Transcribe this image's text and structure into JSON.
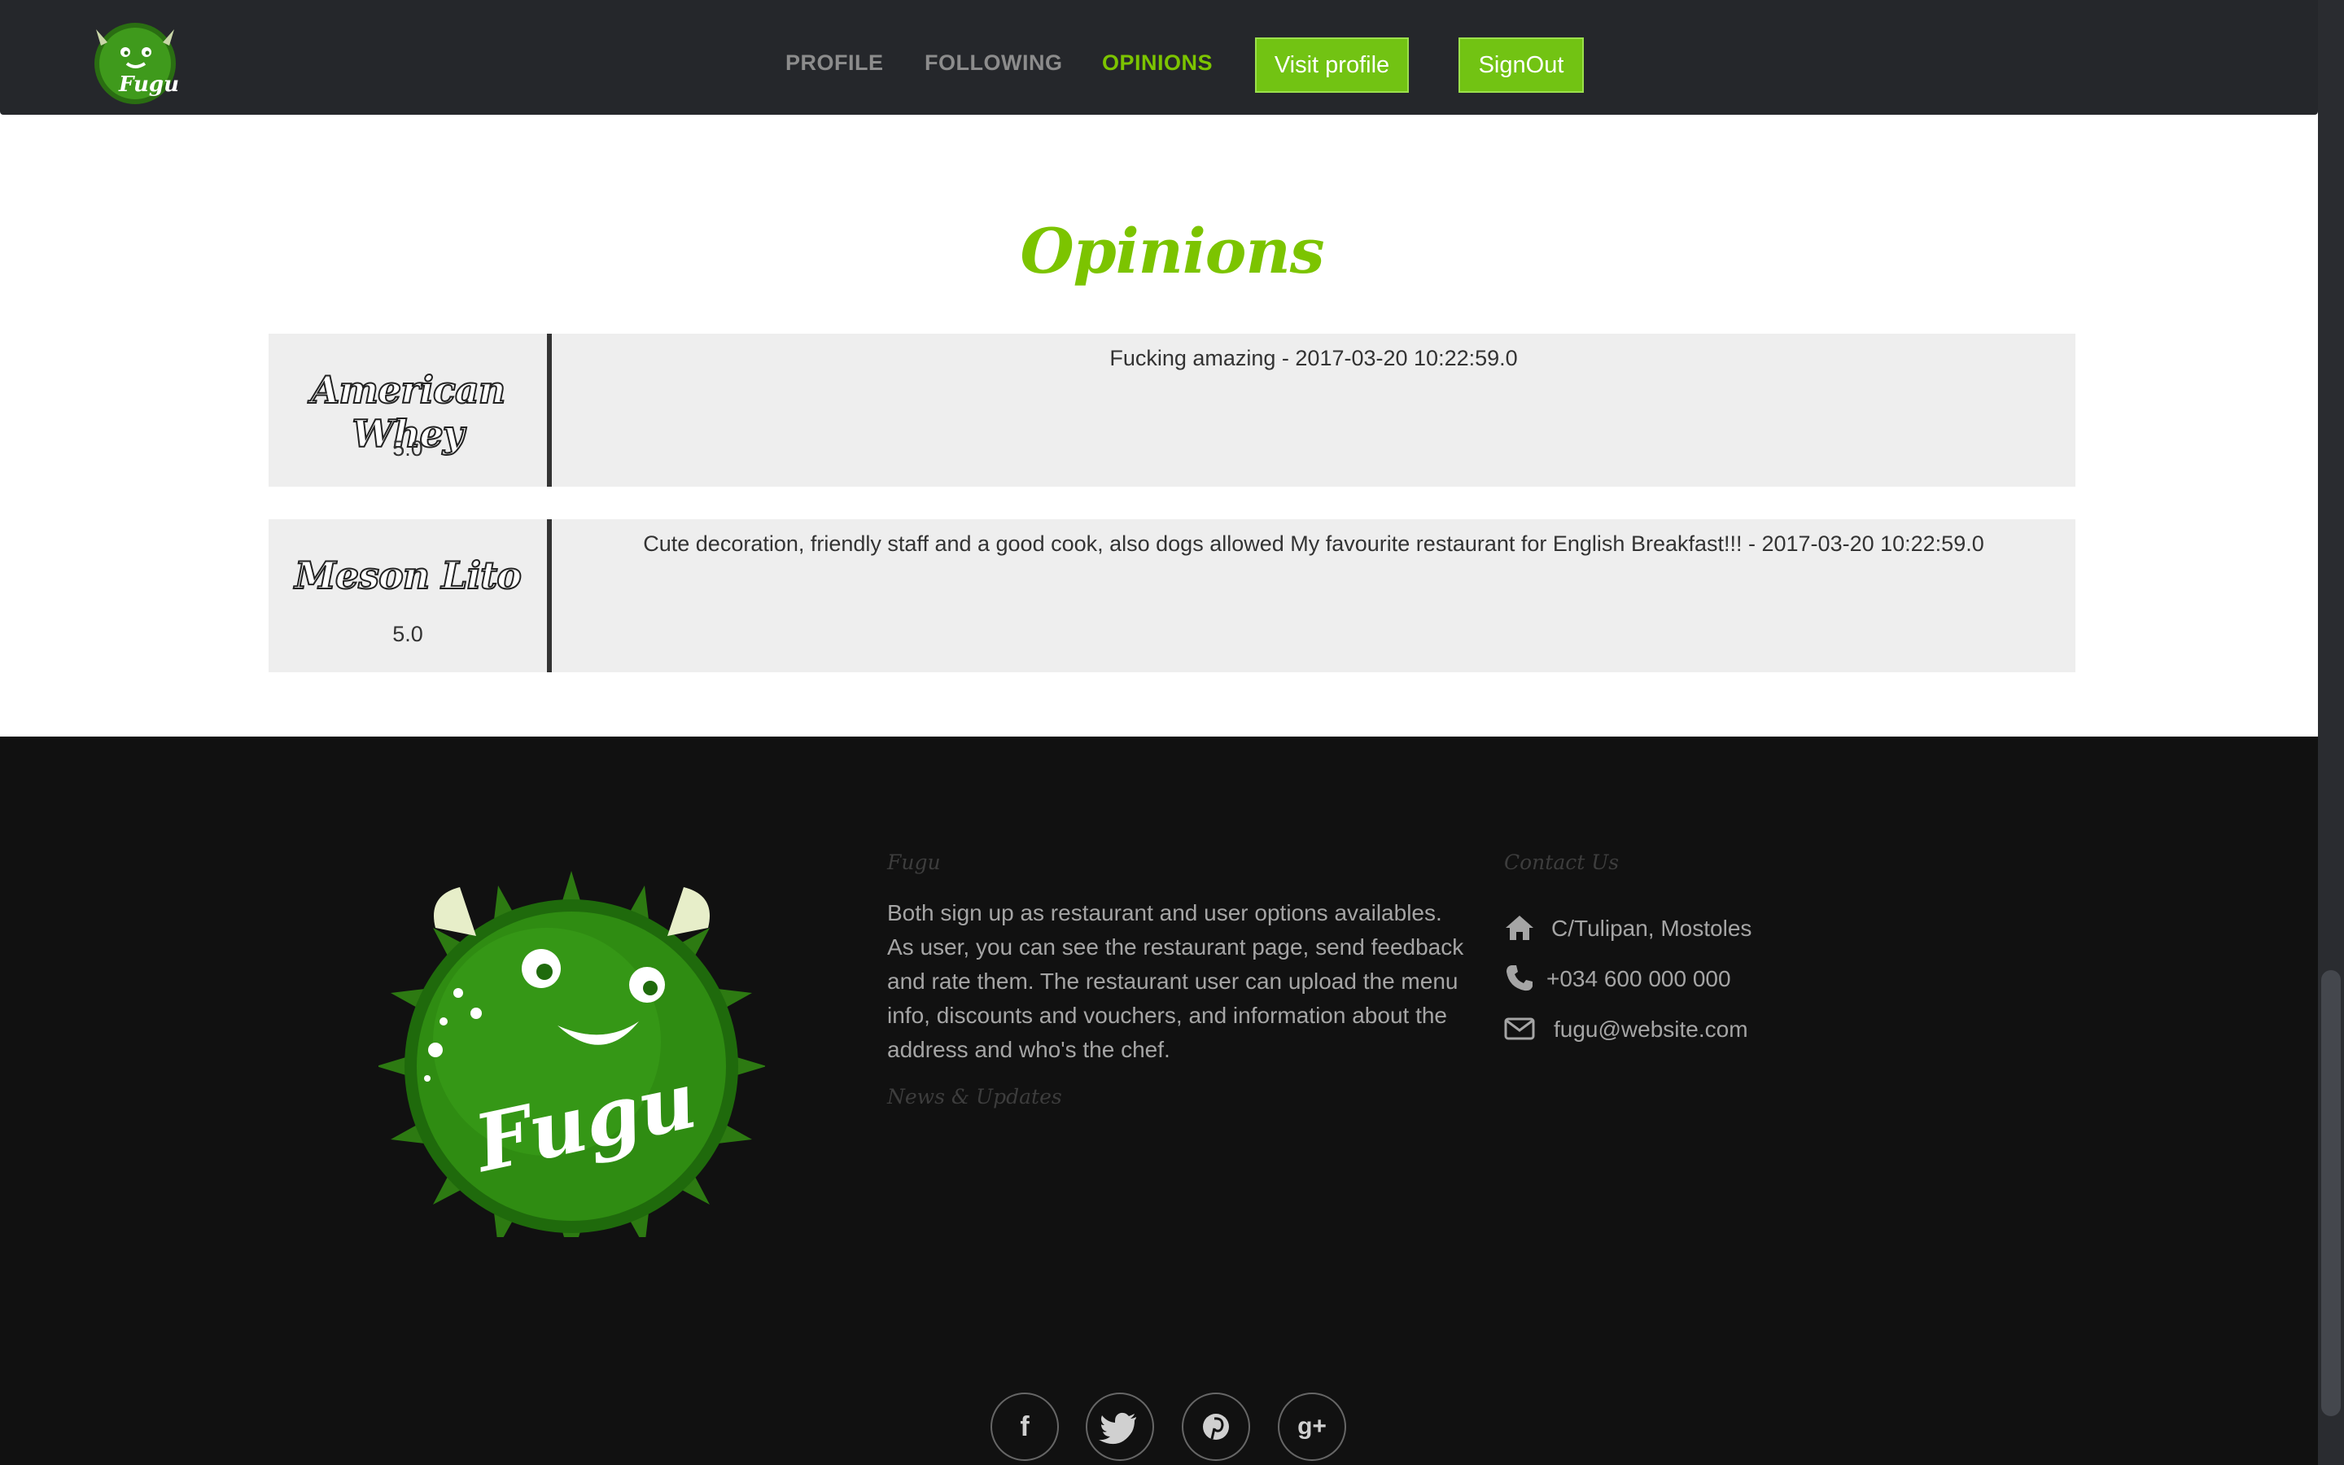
{
  "nav": {
    "links": [
      "PROFILE",
      "FOLLOWING",
      "OPINIONS"
    ],
    "visit_profile": "Visit profile",
    "signout": "SignOut"
  },
  "logo": {
    "wordmark": "Fugu"
  },
  "page_title": "Opinions",
  "opinions": [
    {
      "restaurant": "American Whey",
      "rating": "5.0",
      "text": "Fucking amazing - 2017-03-20 10:22:59.0"
    },
    {
      "restaurant": "Meson Lito",
      "rating": "5.0",
      "text": "Cute decoration, friendly staff and a good cook, also dogs allowed My favourite restaurant for English Breakfast!!! - 2017-03-20 10:22:59.0"
    }
  ],
  "footer": {
    "about_title": "Fugu",
    "about_text": "Both sign up as restaurant and user options availables. As user, you can see the restaurant page, send feedback and rate them. The restaurant user can upload the menu info, discounts and vouchers, and information about the address and who's the chef.",
    "news_title": "News & Updates",
    "contact_title": "Contact Us",
    "address": "C/Tulipan, Mostoles",
    "phone": "+034 600 000 000",
    "email": "fugu@website.com",
    "social": [
      "facebook-icon",
      "twitter-icon",
      "pinterest-icon",
      "google-plus-icon"
    ]
  },
  "colors": {
    "accent": "#7cc400",
    "button": "#72c313",
    "nav_bg": "#25272b",
    "footer_bg": "#111111",
    "card_bg": "#eeeeee"
  }
}
